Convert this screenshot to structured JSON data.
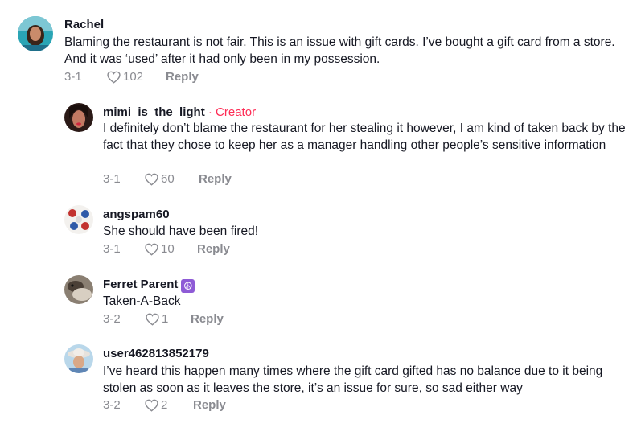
{
  "comments": [
    {
      "username": "Rachel",
      "text": "Blaming the restaurant is not fair. This is an issue with gift cards. I’ve bought a gift card from a store. And it was ‘used’ after it had only been in my possession.",
      "date": "3-1",
      "likes": "102",
      "reply_label": "Reply"
    },
    {
      "username": "mimi_is_the_light",
      "creator_label": "Creator",
      "separator": " · ",
      "text": "I definitely don’t blame the restaurant for her stealing it however, I am kind of taken back by the fact that they chose to keep her as a manager handling other people’s sensitive information",
      "date": "3-1",
      "likes": "60",
      "reply_label": "Reply"
    },
    {
      "username": "angspam60",
      "text": "She should have been fired!",
      "date": "3-1",
      "likes": "10",
      "reply_label": "Reply"
    },
    {
      "username": "Ferret Parent",
      "emoji": "☮",
      "text": "Taken-A-Back",
      "date": "3-2",
      "likes": "1",
      "reply_label": "Reply"
    },
    {
      "username": "user462813852179",
      "text": "I’ve heard this happen many times where the gift card gifted has no balance due to it being stolen as soon as it leaves the store, it’s an issue for sure, so sad either way",
      "date": "3-2",
      "likes": "2",
      "reply_label": "Reply"
    }
  ],
  "icons": {
    "like": "heart-outline-icon"
  },
  "colors": {
    "text": "#161823",
    "meta": "#8a8b91",
    "creator": "#fe2c55"
  }
}
